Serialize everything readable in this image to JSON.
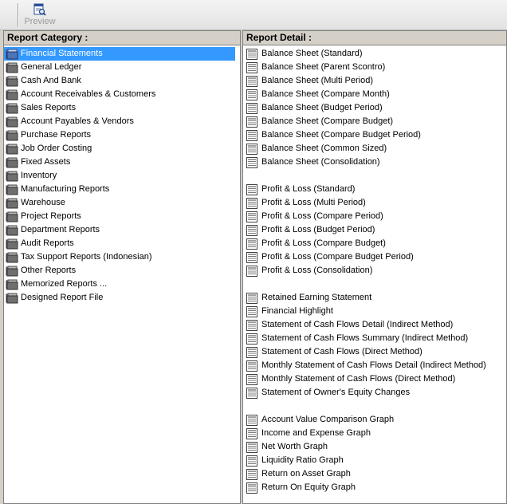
{
  "toolbar": {
    "preview_label": "Preview"
  },
  "left_pane": {
    "header": "Report Category :",
    "items": [
      "Financial Statements",
      "General Ledger",
      "Cash And Bank",
      "Account Receivables & Customers",
      "Sales Reports",
      "Account Payables & Vendors",
      "Purchase Reports",
      "Job Order Costing",
      "Fixed Assets",
      "Inventory",
      "Manufacturing Reports",
      "Warehouse",
      "Project Reports",
      "Department Reports",
      "Audit Reports",
      "Tax Support Reports (Indonesian)",
      "Other Reports",
      "Memorized Reports ...",
      "Designed Report File"
    ],
    "selected": "Financial Statements"
  },
  "right_pane": {
    "header": "Report Detail :",
    "groups": [
      [
        "Balance Sheet (Standard)",
        "Balance Sheet (Parent Scontro)",
        "Balance Sheet (Multi Period)",
        "Balance Sheet (Compare Month)",
        "Balance Sheet (Budget Period)",
        "Balance Sheet (Compare Budget)",
        "Balance Sheet (Compare Budget Period)",
        "Balance Sheet (Common Sized)",
        "Balance Sheet (Consolidation)"
      ],
      [
        "Profit & Loss (Standard)",
        "Profit & Loss (Multi Period)",
        "Profit & Loss (Compare Period)",
        "Profit & Loss (Budget Period)",
        "Profit & Loss (Compare Budget)",
        "Profit & Loss (Compare Budget Period)",
        "Profit & Loss (Consolidation)"
      ],
      [
        "Retained Earning Statement",
        "Financial Highlight",
        "Statement of Cash Flows Detail (Indirect Method)",
        "Statement of Cash Flows Summary (Indirect Method)",
        "Statement of Cash Flows (Direct Method)",
        "Monthly Statement of Cash Flows Detail (Indirect Method)",
        "Monthly Statement of Cash Flows (Direct Method)",
        "Statement of Owner's Equity Changes"
      ],
      [
        "Account Value Comparison Graph",
        "Income and Expense Graph",
        "Net Worth Graph",
        "Liquidity Ratio Graph",
        "Return on Asset Graph",
        "Return On Equity Graph"
      ]
    ]
  }
}
